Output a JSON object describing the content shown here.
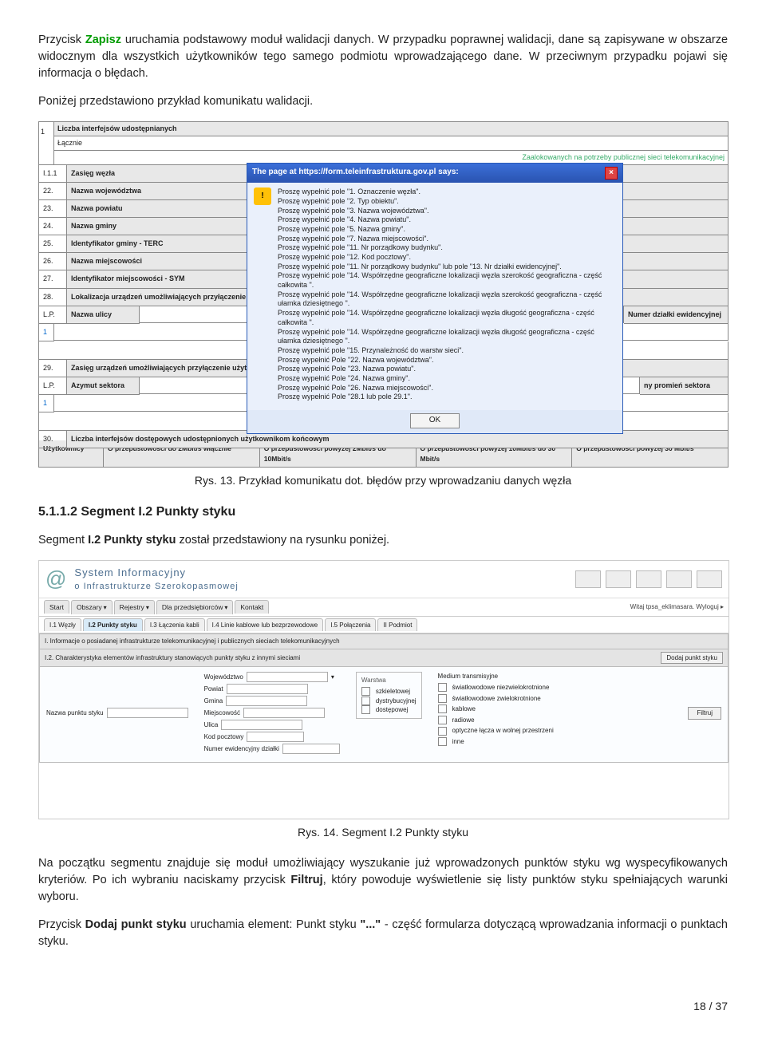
{
  "intro": {
    "p1_a": "Przycisk ",
    "p1_btn": "Zapisz",
    "p1_b": " uruchamia podstawowy moduł walidacji danych. W przypadku poprawnej walidacji, dane są zapisywane w obszarze widocznym dla wszystkich użytkowników tego samego podmiotu wprowadzającego dane. W przeciwnym przypadku pojawi się informacja o błędach.",
    "p2": "Poniżej przedstawiono przykład komunikatu walidacji."
  },
  "fig1": {
    "toprownum": "1",
    "toprow_label": "Liczba interfejsów udostępnianych",
    "lacznie": "Łącznie",
    "zaalokowanych": "Zaalokowanych na potrzeby publicznej sieci telekomunikacyjnej",
    "rows": {
      "r111": {
        "num": "I.1.1",
        "lbl": "Zasięg węzła"
      },
      "r22": {
        "num": "22.",
        "lbl": "Nazwa województwa"
      },
      "r23": {
        "num": "23.",
        "lbl": "Nazwa powiatu"
      },
      "r24": {
        "num": "24.",
        "lbl": "Nazwa gminy"
      },
      "r25": {
        "num": "25.",
        "lbl": "Identyfikator gminy - TERC"
      },
      "r26": {
        "num": "26.",
        "lbl": "Nazwa miejscowości"
      },
      "r27": {
        "num": "27.",
        "lbl": "Identyfikator miejscowości - SYM"
      },
      "r28": {
        "num": "28.",
        "lbl": "Lokalizacja urządzeń umożliwiających przyłączenie użytkowników końcowych"
      },
      "lp": {
        "num": "L.P.",
        "lbl": "Nazwa ulicy",
        "right": "Numer działki ewidencyjnej"
      },
      "lp1": {
        "num": "1"
      },
      "r29": {
        "num": "29.",
        "lbl": "Zasięg urządzeń umożliwiających przyłączenie użytkowników końcowych w radiow..."
      },
      "lp2": {
        "num": "L.P.",
        "lbl": "Azymut sektora",
        "right": "ny promień sektora"
      },
      "lp21": {
        "num": "1"
      },
      "r30": {
        "num": "30.",
        "lbl": "Liczba interfejsów dostępowych udostępnionych użytkownikom końcowym"
      }
    },
    "footer": {
      "uzyt": "Użytkownicy",
      "c1": "O przepustowości do 2Mbit/s włącznie",
      "c2": "O przepustowości powyżej 2Mbit/s do 10Mbit/s",
      "c3": "O przepustowości powyżej 10Mbit/s do 30 Mbit/s",
      "c4": "O przepustowości powyżej 30 Mbit/s"
    },
    "dialog": {
      "title": "The page at https://form.teleinfrastruktura.gov.pl says:",
      "lines": [
        "Proszę wypełnić pole \"1. Oznaczenie węzła\".",
        "Proszę wypełnić pole \"2. Typ obiektu\".",
        "Proszę wypełnić pole \"3. Nazwa województwa\".",
        "Proszę wypełnić pole \"4. Nazwa powiatu\".",
        "Proszę wypełnić pole \"5. Nazwa gminy\".",
        "Proszę wypełnić pole \"7. Nazwa miejscowości\".",
        "Proszę wypełnić pole \"11. Nr porządkowy budynku\".",
        "Proszę wypełnić pole \"12. Kod pocztowy\".",
        "Proszę wypełnić pole \"11. Nr porządkowy budynku\" lub pole \"13. Nr działki ewidencyjnej\".",
        "Proszę wypełnić pole \"14. Współrzędne geograficzne lokalizacji węzła szerokość geograficzna - część całkowita \".",
        "Proszę wypełnić pole \"14. Współrzędne geograficzne lokalizacji węzła szerokość geograficzna - część ułamka dziesiętnego \".",
        "Proszę wypełnić pole \"14. Współrzędne geograficzne lokalizacji węzła długość geograficzna - część całkowita \".",
        "Proszę wypełnić pole \"14. Współrzędne geograficzne lokalizacji węzła długość geograficzna - część ułamka dziesiętnego \".",
        "Proszę wypełnić pole \"15. Przynależność do warstw sieci\".",
        "Proszę wypełnić Pole \"22. Nazwa województwa\".",
        "Proszę wypełnić Pole \"23. Nazwa powiatu\".",
        "Proszę wypełnić Pole \"24. Nazwa gminy\".",
        "Proszę wypełnić Pole \"26. Nazwa miejscowości\".",
        "Proszę wypełnić Pole \"28.1 lub pole 29.1\"."
      ],
      "ok": "OK"
    },
    "caption": "Rys. 13. Przykład komunikatu dot. błędów przy wprowadzaniu danych węzła"
  },
  "section": {
    "heading": "5.1.1.2    Segment I.2 Punkty styku",
    "p3_a": "Segment ",
    "p3_b": "I.2 Punkty styku",
    "p3_c": " został przedstawiony na rysunku poniżej."
  },
  "fig2": {
    "header": {
      "t1": "System Informacyjny",
      "t2": "o Infrastrukturze Szerokopasmowej"
    },
    "tabs": {
      "start": "Start",
      "obszary": "Obszary",
      "rejestry": "Rejestry",
      "dlap": "Dla przedsiębiorców",
      "kontakt": "Kontakt",
      "user": "Witaj tpsa_eklimasara. Wyloguj ▸"
    },
    "subtabs": {
      "i11": "I.1 Węzły",
      "i12": "I.2 Punkty styku",
      "i13": "I.3 Łączenia kabli",
      "i14": "I.4 Linie kablowe lub bezprzewodowe",
      "i15": "I.5 Połączenia",
      "ii": "II Podmiot"
    },
    "bar1": "I. Informacje o posiadanej infrastrukturze telekomunikacyjnej i publicznych sieciach telekomunikacyjnych",
    "bar2": "I.2. Charakterystyka elementów infrastruktury stanowiących punkty styku z innymi sieciami",
    "dodaj": "Dodaj punkt styku",
    "filter": {
      "nazwa": "Nazwa punktu styku",
      "woj": "Województwo",
      "pow": "Powiat",
      "gmi": "Gmina",
      "mie": "Miejscowość",
      "uli": "Ulica",
      "kod": "Kod pocztowy",
      "ned": "Numer ewidencyjny działki",
      "warstwa_t": "Warstwa",
      "w1": "szkieletowej",
      "w2": "dystrybucyjnej",
      "w3": "dostępowej",
      "medium_t": "Medium transmisyjne",
      "m1": "światłowodowe niezwielokrotnione",
      "m2": "światłowodowe zwielokrotnione",
      "m3": "kablowe",
      "m4": "radiowe",
      "m5": "optyczne łącza w wolnej przestrzeni",
      "m6": "inne",
      "filtruj": "Filtruj"
    },
    "caption": "Rys. 14. Segment I.2 Punkty styku"
  },
  "outro": {
    "p4_a": "Na początku segmentu znajduje się moduł umożliwiający wyszukanie już wprowadzonych punktów styku wg wyspecyfikowanych kryteriów. Po ich wybraniu naciskamy przycisk ",
    "p4_b": "Filtruj",
    "p4_c": ", który powoduje wyświetlenie się listy punktów styku spełniających warunki wyboru.",
    "p5_a": "Przycisk ",
    "p5_b": "Dodaj punkt styku",
    "p5_c": " uruchamia element: Punkt styku ",
    "p5_d": "\"...\"",
    "p5_e": " - część formularza dotyczącą wprowadzania informacji o punktach styku."
  },
  "page": "18 / 37"
}
